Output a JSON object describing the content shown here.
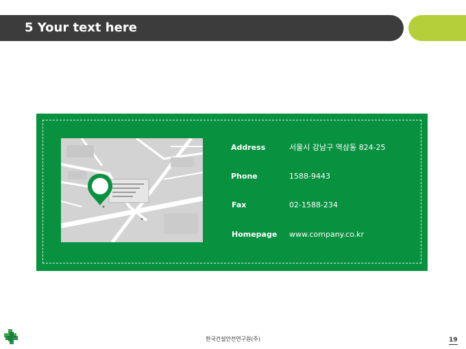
{
  "header": {
    "title": "5 Your text here",
    "bar_color": "#3c3c3c",
    "accent_color": "#b5cf3a"
  },
  "contact_panel": {
    "background_color": "#08913f",
    "map": {
      "icon": "map-pin-icon"
    },
    "rows": [
      {
        "label": "Address",
        "value": "서울시 강남구 역삼동 824-25"
      },
      {
        "label": "Phone",
        "value": "1588-9443"
      },
      {
        "label": "Fax",
        "value": "02-1588-234"
      },
      {
        "label": "Homepage",
        "value": "www.company.co.kr"
      }
    ]
  },
  "footer": {
    "logo_icon": "green-cross-logo-icon",
    "company": "한국건설안전연구원(주)",
    "page_number": "19"
  }
}
